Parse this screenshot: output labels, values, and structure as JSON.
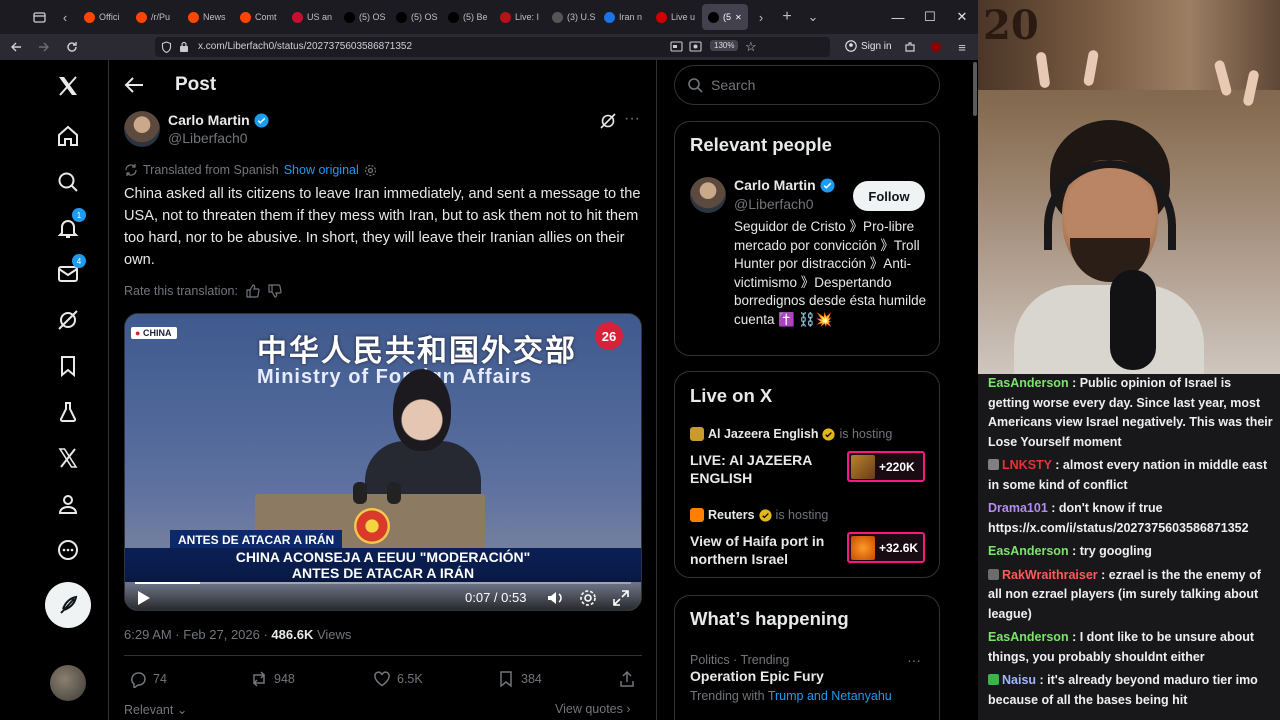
{
  "browser": {
    "tabs": [
      {
        "label": "Offici",
        "icon": "reddit-icon",
        "color": "#ff4500"
      },
      {
        "label": "/r/Pu",
        "icon": "reddit-icon",
        "color": "#ff4500"
      },
      {
        "label": "News",
        "icon": "reddit-icon",
        "color": "#ff4500"
      },
      {
        "label": "Comt",
        "icon": "reddit-icon",
        "color": "#ff4500"
      },
      {
        "label": "US an",
        "icon": "news-icon",
        "color": "#c8102e"
      },
      {
        "label": "(5) OS",
        "icon": "x-icon",
        "color": "#000000"
      },
      {
        "label": "(5) OS",
        "icon": "x-icon",
        "color": "#000000"
      },
      {
        "label": "(5) Be",
        "icon": "x-icon",
        "color": "#000000"
      },
      {
        "label": "Live: I",
        "icon": "live-icon",
        "color": "#b5121b"
      },
      {
        "label": "(3) U.S",
        "icon": "threads-icon",
        "color": "#555555"
      },
      {
        "label": "Iran n",
        "icon": "article-icon",
        "color": "#1a73e8"
      },
      {
        "label": "Live u",
        "icon": "live-icon",
        "color": "#cc0000"
      },
      {
        "label": "(5",
        "icon": "x-icon",
        "color": "#000000",
        "active": true
      }
    ],
    "url": "x.com/Liberfach0/status/2027375603586871352",
    "zoom": "130%",
    "sign_in": "Sign in"
  },
  "nav": {
    "notifications_badge": "1",
    "messages_badge": "4"
  },
  "post": {
    "header_title": "Post",
    "author_name": "Carlo Martin",
    "author_handle": "@Liberfach0",
    "translated_label": "Translated from Spanish",
    "show_original": "Show original",
    "text": "China asked all its citizens to leave Iran immediately, and sent a message to the USA, not to threaten them if they mess with Iran, but to ask them not to hit them too hard, nor to be abusive. In short, they will leave their Iranian allies on their own.",
    "rate_translation": "Rate this translation:",
    "video": {
      "tag": "CHINA",
      "banner_cn": "中华人民共和国外交部",
      "banner_en": "Ministry of Foreign Affairs",
      "channel_logo": "26",
      "chyron_top": "ANTES DE ATACAR A IRÁN",
      "chyron_line1": "CHINA ACONSEJA A EEUU \"MODERACIÓN\"",
      "chyron_line2": "ANTES DE ATACAR A IRÁN",
      "time": "0:07 / 0:53",
      "progress": 0.132
    },
    "timestamp": "6:29 AM · Feb 27, 2026 · ",
    "views_count": "486.6K",
    "views_label": " Views",
    "replies": "74",
    "reposts": "948",
    "likes": "6.5K",
    "bookmarks": "384",
    "relevant_label": "Relevant",
    "view_quotes": "View quotes"
  },
  "sidebar": {
    "search_placeholder": "Search",
    "relevant_people": {
      "title": "Relevant people",
      "name": "Carlo Martin",
      "handle": "@Liberfach0",
      "follow_label": "Follow",
      "bio": "Seguidor de Cristo 》Pro-libre mercado por convicción 》Troll Hunter por distracción 》Anti-victimismo 》Despertando borredignos desde ésta humilde cuenta ✝️ ⛓️💥"
    },
    "live": {
      "title": "Live on X",
      "spaces": [
        {
          "host": "Al Jazeera English",
          "hosting": " is hosting",
          "title": "LIVE: Al JAZEERA ENGLISH",
          "listeners": "+220K",
          "color": "#c99a2e"
        },
        {
          "host": "Reuters",
          "hosting": " is hosting",
          "title": "View of Haifa port in northern Israel",
          "listeners": "+32.6K",
          "color": "#ff8000"
        }
      ]
    },
    "happening": {
      "title": "What’s happening",
      "category": "Politics · Trending",
      "trend": "Operation Epic Fury",
      "trending_with": "Trending with ",
      "trending_names": "Trump and Netanyahu"
    }
  },
  "chat": {
    "messages": [
      {
        "user": "EasAnderson",
        "color": "#7ce36b",
        "text": "Public opinion of Israel is getting worse every day. Since last year, most Americans view Israel negatively. This was their Lose Yourself moment"
      },
      {
        "user": "LNKSTY",
        "color": "#e03636",
        "text": "almost every nation in middle east in some kind of conflict",
        "badge": "#808080"
      },
      {
        "user": "Drama101",
        "color": "#b48cf0",
        "text": "don't know if true https://x.com/i/status/2027375603586871352"
      },
      {
        "user": "EasAnderson",
        "color": "#7ce36b",
        "text": "try googling"
      },
      {
        "user": "RakWraithraiser",
        "color": "#ff5a5a",
        "text": "ezrael is the the enemy of all non ezrael players (im surely talking about league)",
        "badge": "#6b6b6b"
      },
      {
        "user": "EasAnderson",
        "color": "#7ce36b",
        "text": "I dont like to be unsure about things, you probably shouldnt either"
      },
      {
        "user": "Naisu",
        "color": "#9fb6ff",
        "text": "it's already beyond maduro tier imo because of all the bases being hit",
        "badge": "#3bb54a"
      }
    ]
  },
  "webcam": {
    "seal_text": "20"
  }
}
